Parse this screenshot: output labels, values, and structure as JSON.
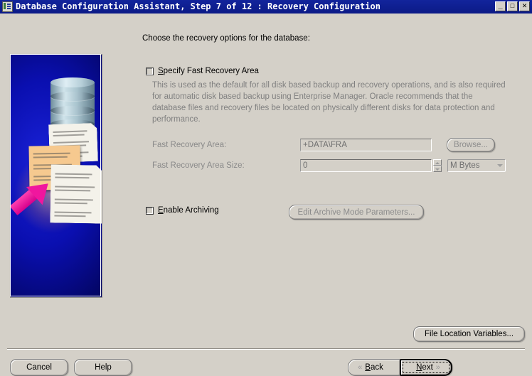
{
  "window": {
    "title": "Database Configuration Assistant, Step 7 of 12 : Recovery Configuration",
    "icon": "database-app-icon",
    "controls": {
      "minimize": "_",
      "maximize": "□",
      "close": "✕"
    }
  },
  "colors": {
    "titlebar": "#12249c",
    "face": "#d4d0c8",
    "disabled_text": "#808080",
    "panel_blue": "#0a0fb0",
    "arrow_magenta": "#f0169e"
  },
  "sidebar_graphic": {
    "name": "recovery-illustration",
    "elements": [
      "database-cylinder",
      "document-sheets",
      "magenta-arrow",
      "orange-glow"
    ]
  },
  "main": {
    "intro": "Choose the recovery options for the database:",
    "specify_fra": {
      "label": "Specify Fast Recovery Area",
      "checked": false,
      "mnemonic": "S"
    },
    "description": "This is used as the default for all disk based backup and recovery operations, and is also required for automatic disk based backup using Enterprise Manager. Oracle recommends that the database files and recovery files be located on physically different disks for data protection and performance.",
    "fields": [
      {
        "label": "Fast Recovery Area:",
        "value": "+DATA\\FRA",
        "placeholder": "",
        "disabled": true,
        "button": "Browse..."
      },
      {
        "label": "Fast Recovery Area Size:",
        "value": "0",
        "placeholder": "",
        "disabled": true,
        "spinner": true,
        "unit": "M Bytes"
      }
    ],
    "enable_archiving": {
      "label": "Enable Archiving",
      "checked": false,
      "mnemonic": "E",
      "button": "Edit Archive Mode Parameters..."
    },
    "file_location_button": "File Location Variables..."
  },
  "footer": {
    "cancel": "Cancel",
    "help": "Help",
    "back": "Back",
    "back_mnemonic": "B",
    "next": "Next",
    "next_mnemonic": "N",
    "back_chevron": "«",
    "next_chevron": "»"
  }
}
